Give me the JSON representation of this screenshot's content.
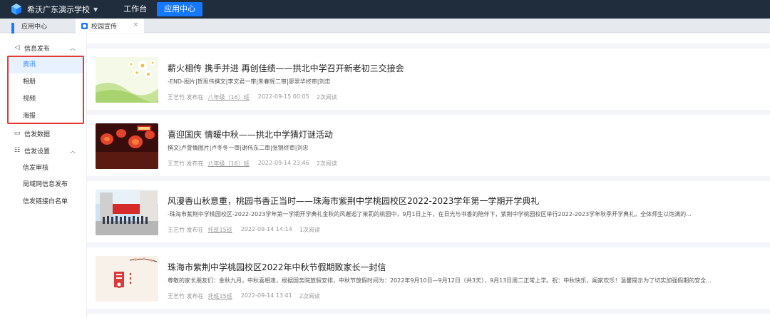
{
  "topbar": {
    "school_name": "希沃广东演示学校",
    "nav": [
      {
        "label": "工作台",
        "active": false
      },
      {
        "label": "应用中心",
        "active": true
      }
    ]
  },
  "tabs": {
    "home": "应用中心",
    "active": "校园宣传",
    "close_glyph": "×"
  },
  "sidebar": {
    "group_publish": "信息发布",
    "publish_items": [
      "资讯",
      "相册",
      "视频",
      "海报"
    ],
    "group_stats": "信发数据",
    "group_settings": "信发设置",
    "settings_items": [
      "信发审核",
      "局域网信息发布",
      "信发链接白名单"
    ]
  },
  "articles": [
    {
      "title": "薪火相传 携手并进 再创佳绩——拱北中学召开新老初三交接会",
      "desc": "-END-图片|贺思伟撰文|李文君一审|朱春辉二审|廖翠华终审|刘忠",
      "author": "王艺竹 发布在",
      "cls": "八年级（16）班",
      "date": "2022-09-15 00:05",
      "reads": "2次阅读"
    },
    {
      "title": "喜迎国庆 情暖中秋——拱北中学猜灯谜活动",
      "desc": "撰文|卢萱情图片|卢冬冬一审|谢伟东二审|张锦终审|刘忠",
      "author": "王艺竹 发布在",
      "cls": "八年级（16）班",
      "date": "2022-09-14 23:46",
      "reads": "2次阅读"
    },
    {
      "title": "风漫香山秋意重，桃园书香正当时——珠海市紫荆中学桃园校区2022-2023学年第一学期开学典礼",
      "desc": "-珠海市紫荆中学桃园校区-2022-2023学年第一学期开学典礼金秋的风邂逅了茉莉的桃园中，9月1日上午，在日光与书香的陪伴下，紫荆中学桃园校区举行2022-2023学年秋季开学典礼，全体师生以饱满的...",
      "author": "王艺竹 发布在",
      "cls": "托班15班",
      "date": "2022-09-14 14:14",
      "reads": "1次阅读"
    },
    {
      "title": "珠海市紫荆中学桃园校区2022年中秋节假期致家长一封信",
      "desc": "尊敬的家长朋友们：金秋九月，中秋喜相逢，根据国务院放假安排，中秋节放假时间为：2022年9月10日—9月12日（共3天），9月13日周二正常上学。祝：中秋快乐，阖家欢乐！温馨提示为了切实加强假期的安全...",
      "author": "王艺竹 发布在",
      "cls": "托班15班",
      "date": "2022-09-14 13:41",
      "reads": "2次阅读"
    }
  ],
  "colors": {
    "topbar": "#1f2d3d",
    "accent": "#1677ff",
    "highlight": "#e53935"
  }
}
